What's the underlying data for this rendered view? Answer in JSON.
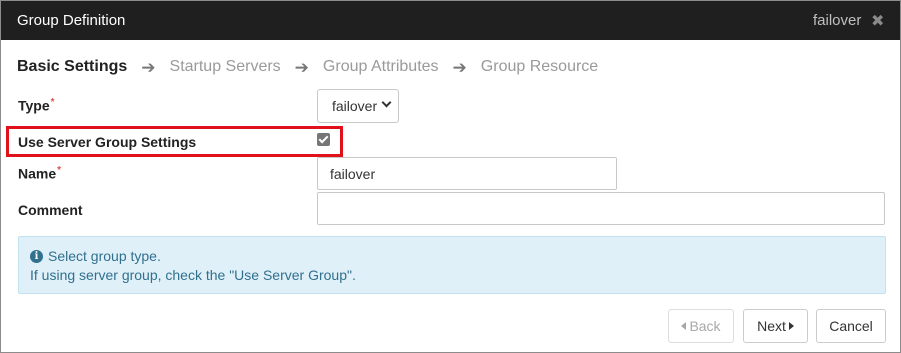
{
  "dialog": {
    "title": "Group Definition",
    "group_name": "failover",
    "close_icon": "close-icon"
  },
  "wizard": {
    "steps": [
      "Basic Settings",
      "Startup Servers",
      "Group Attributes",
      "Group Resource"
    ],
    "active_step": 0
  },
  "form": {
    "type_label": "Type",
    "type_value": "failover",
    "use_server_group_label": "Use Server Group Settings",
    "use_server_group_checked": true,
    "name_label": "Name",
    "name_value": "failover",
    "comment_label": "Comment",
    "comment_value": "",
    "required_marker": "*"
  },
  "info": {
    "icon": "info-icon",
    "line1": "Select group type.",
    "line2": "If using server group, check the \"Use Server Group\"."
  },
  "buttons": {
    "back": "Back",
    "next": "Next",
    "cancel": "Cancel"
  },
  "colors": {
    "titlebar": "#1f1f1f",
    "highlight": "#e0111b",
    "info_bg": "#dff0f8",
    "info_text": "#31708f",
    "required": "#d9534f"
  }
}
